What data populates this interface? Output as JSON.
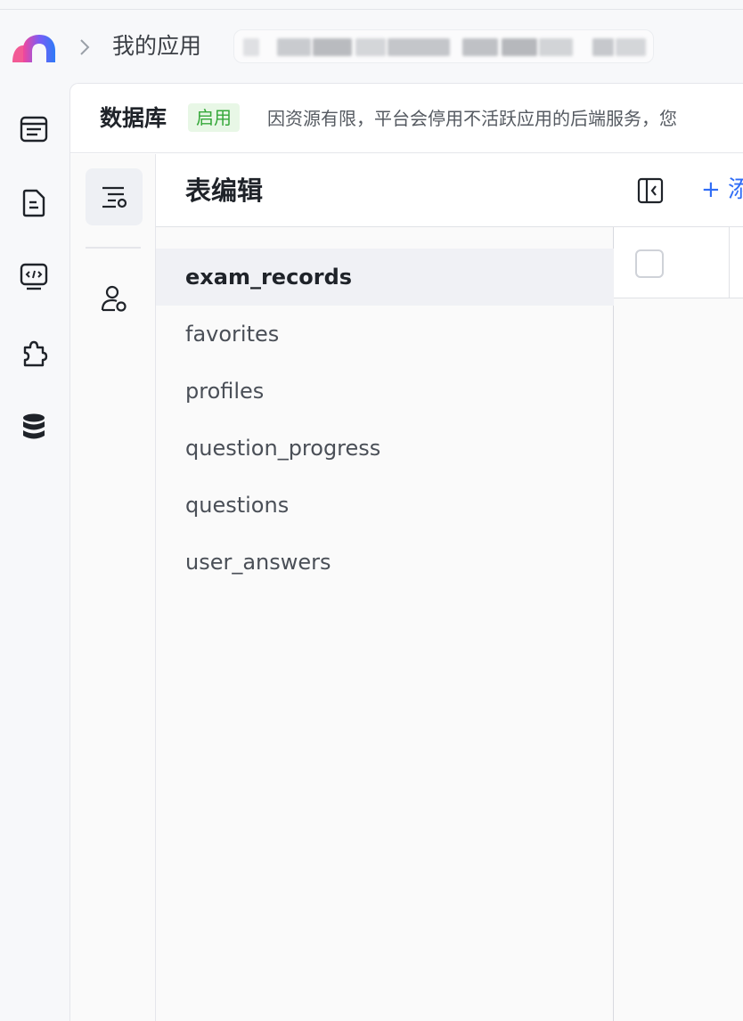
{
  "header": {
    "breadcrumb_label": "我的应用"
  },
  "panel": {
    "title": "数据库",
    "status": "启用",
    "notice": "因资源有限，平台会停用不活跃应用的后端服务，您"
  },
  "tables": {
    "heading": "表编辑",
    "items": [
      {
        "name": "exam_records"
      },
      {
        "name": "favorites"
      },
      {
        "name": "profiles"
      },
      {
        "name": "question_progress"
      },
      {
        "name": "questions"
      },
      {
        "name": "user_answers"
      }
    ],
    "selected_index": 0
  },
  "grid": {
    "add_label": "+ 添加"
  },
  "colors": {
    "accent": "#2f6cf6",
    "status_green": "#36a83a"
  }
}
